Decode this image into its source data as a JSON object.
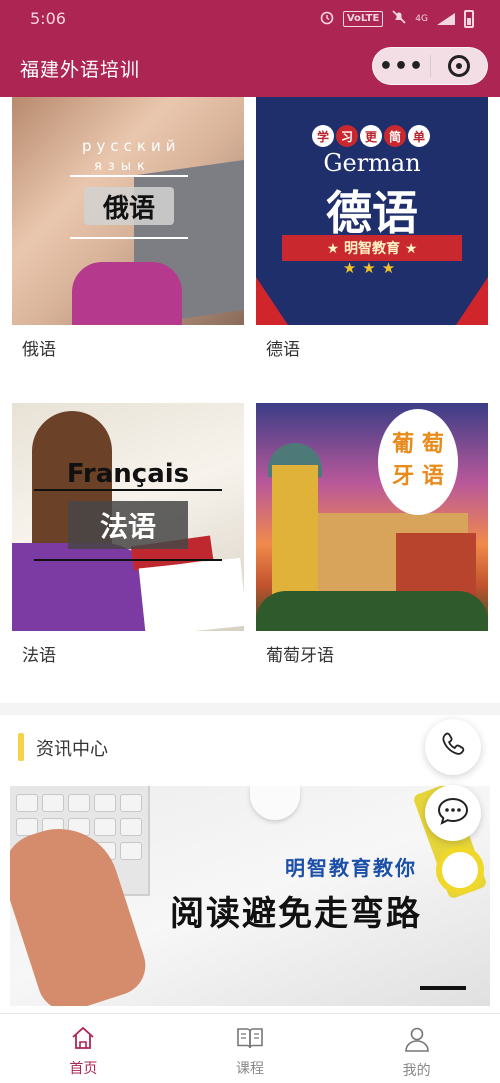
{
  "status_bar": {
    "time": "5:06",
    "network_badge": "VoLTE",
    "network_type": "4G"
  },
  "header": {
    "title": "福建外语培训",
    "more_glyph": "•••",
    "accent": "#ad2553"
  },
  "courses": [
    {
      "label": "俄语",
      "thumb": {
        "line1": "русский",
        "line2": "язык",
        "box": "俄语"
      }
    },
    {
      "label": "德语",
      "thumb": {
        "chars": [
          "学",
          "习",
          "更",
          "简",
          "单"
        ],
        "en": "German",
        "cn": "德语",
        "ribbon": "★ 明智教育 ★",
        "stars": "★★★"
      }
    },
    {
      "label": "法语",
      "thumb": {
        "title": "Français",
        "box": "法语"
      }
    },
    {
      "label": "葡萄牙语",
      "thumb": {
        "line1": "葡 萄",
        "line2": "牙 语"
      }
    }
  ],
  "news": {
    "section_title": "资讯中心",
    "accent": "#f3d34a",
    "banner": {
      "subtitle": "明智教育教你",
      "headline": "阅读避免走弯路"
    }
  },
  "floating": {
    "phone_icon": "phone-icon",
    "chat_icon": "chat-icon"
  },
  "tabbar": {
    "tabs": [
      {
        "label": "首页",
        "icon": "home-icon",
        "active": true
      },
      {
        "label": "课程",
        "icon": "book-icon",
        "active": false
      },
      {
        "label": "我的",
        "icon": "user-icon",
        "active": false
      }
    ]
  }
}
